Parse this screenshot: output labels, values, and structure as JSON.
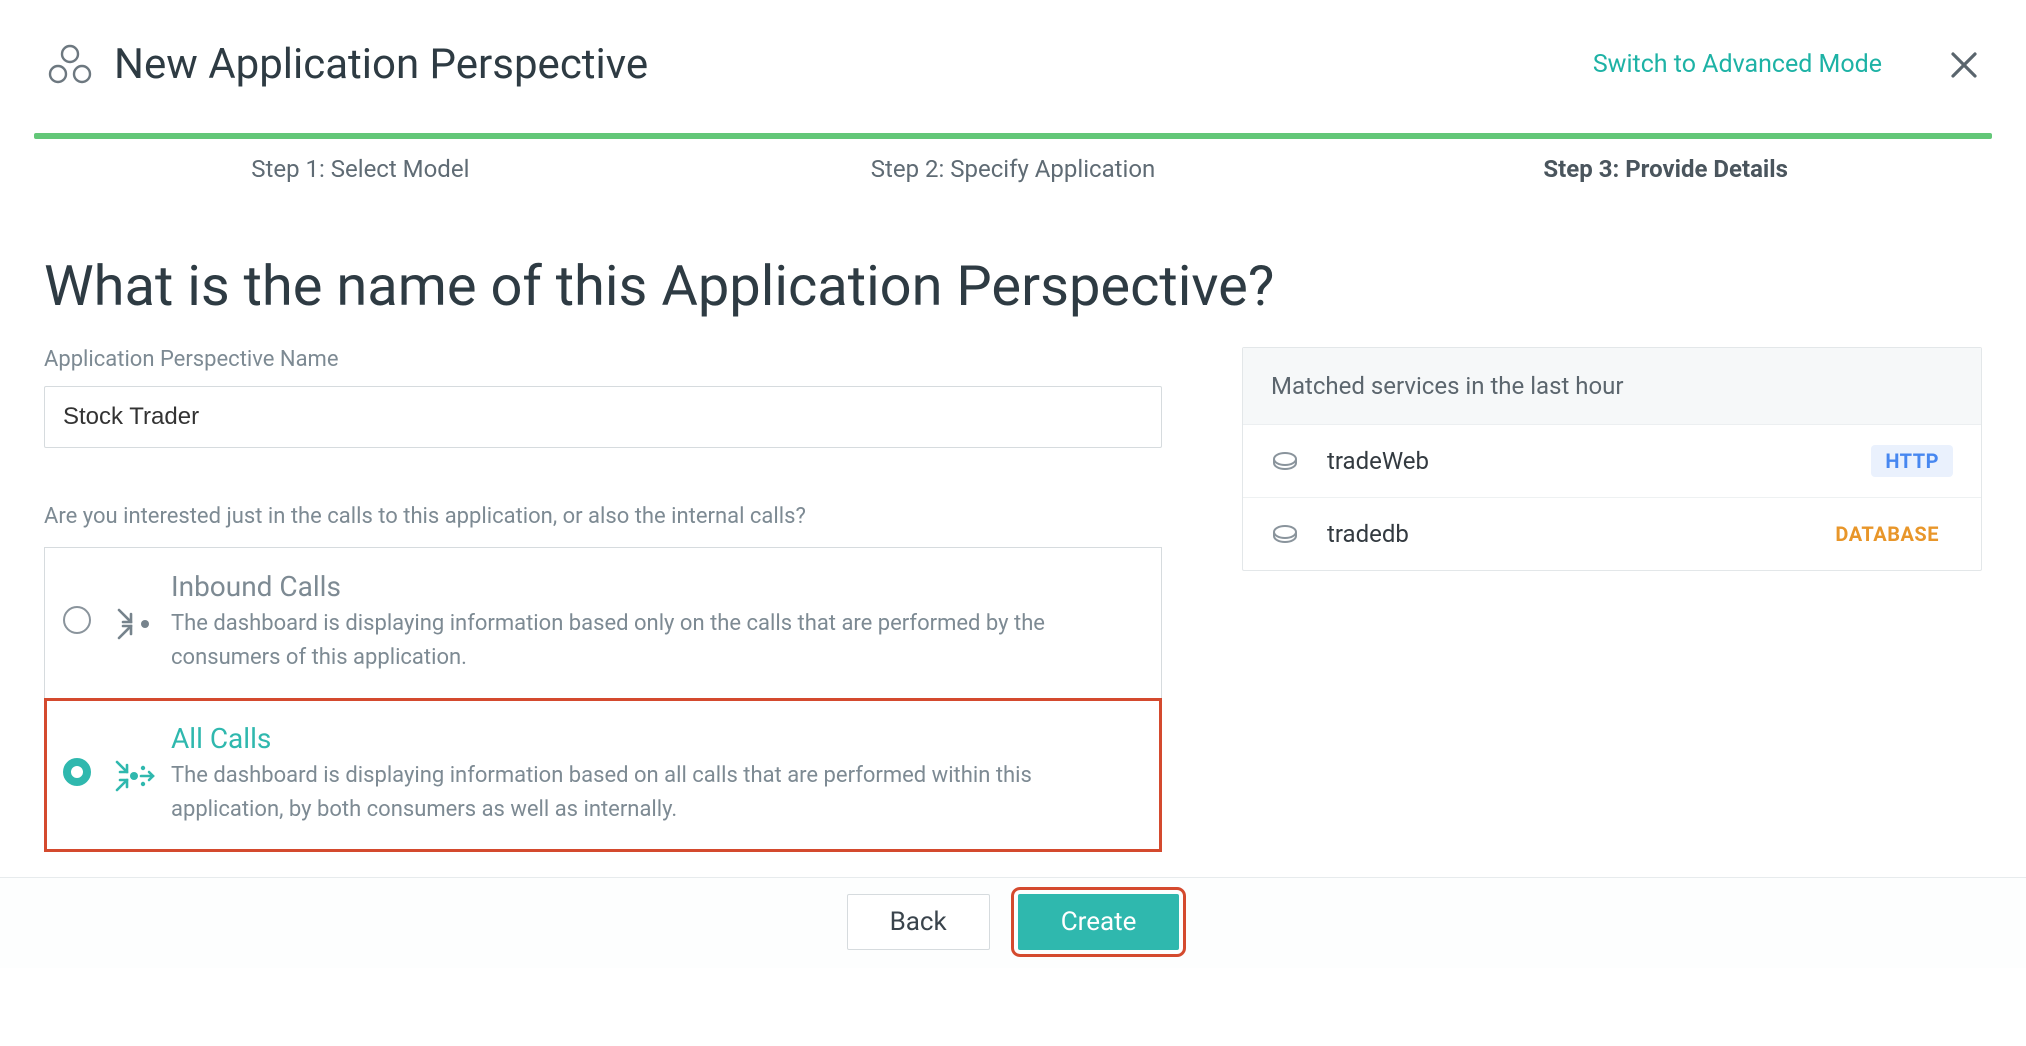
{
  "header": {
    "title": "New Application Perspective",
    "mode_link": "Switch to Advanced Mode"
  },
  "steps": {
    "items": [
      {
        "label": "Step 1: Select Model"
      },
      {
        "label": "Step 2: Specify Application"
      },
      {
        "label": "Step 3: Provide Details"
      }
    ],
    "active_index": 2
  },
  "main": {
    "question": "What is the name of this Application Perspective?",
    "name_field": {
      "label": "Application Perspective Name",
      "value": "Stock Trader"
    },
    "calls_question": "Are you interested just in the calls to this application, or also the internal calls?",
    "options": [
      {
        "id": "inbound",
        "title": "Inbound Calls",
        "desc": "The dashboard is displaying information based only on the calls that are performed by the consumers of this application.",
        "selected": false
      },
      {
        "id": "all",
        "title": "All Calls",
        "desc": "The dashboard is displaying information based on all calls that are performed within this application, by both consumers as well as internally.",
        "selected": true
      }
    ]
  },
  "side_panel": {
    "title": "Matched services in the last hour",
    "services": [
      {
        "name": "tradeWeb",
        "badge": "HTTP",
        "badge_kind": "http"
      },
      {
        "name": "tradedb",
        "badge": "DATABASE",
        "badge_kind": "database"
      }
    ]
  },
  "footer": {
    "back": "Back",
    "create": "Create"
  }
}
